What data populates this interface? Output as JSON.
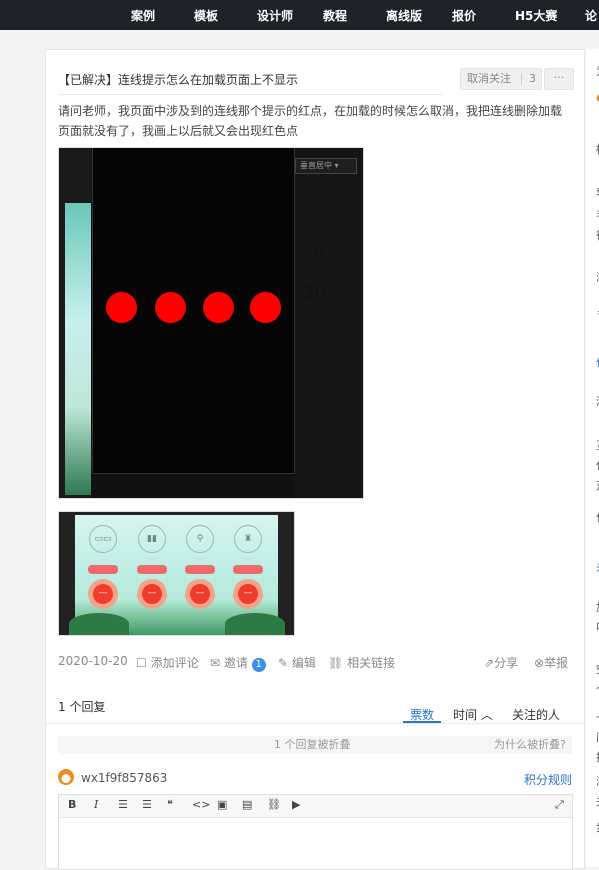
{
  "nav": {
    "items": [
      "案例",
      "模板",
      "设计师",
      "教程",
      "离线版",
      "报价",
      "H5大赛",
      "论"
    ]
  },
  "question": {
    "title": "【已解决】连线提示怎么在加载页面上不显示",
    "unfollow_label": "取消关注",
    "follow_count": "3",
    "more_label": "···",
    "body": "请问老师，我页面中涉及到的连线那个提示的红点，在加载的时候怎么取消，我把连线删除加载页面就没有了，我画上以后就又会出现红色点"
  },
  "screenshot1": {
    "dropdown_label": "垂直居中 ▾",
    "number_top": "0",
    "number_bottom": "30",
    "dot_color": "#ff0000"
  },
  "meta": {
    "date": "2020-10-20",
    "add_comment": "添加评论",
    "invite": "邀请",
    "invite_badge": "1",
    "edit": "编辑",
    "related_links": "相关链接",
    "share": "分享",
    "report": "举报"
  },
  "answers": {
    "count_label": "1 个回复",
    "tabs": [
      "票数",
      "时间 ︿",
      "关注的人"
    ],
    "folded_text": "1 个回复被折叠",
    "why_folded": "为什么被折叠?"
  },
  "editor": {
    "username": "wx1f9f857863",
    "rules_link": "积分规则",
    "toolbar": [
      "B",
      "I",
      "☰",
      "☰",
      "❝",
      "<>",
      "▣",
      "▤",
      "⛓",
      "▶"
    ],
    "fullscreen": "⤢"
  },
  "right_panel": {
    "chars": [
      "为",
      "●",
      "标",
      "导",
      "手",
      "径",
      "浏",
      "〒",
      "作",
      "浏",
      "互",
      "作",
      "对",
      "作",
      "未",
      "加",
      "叫",
      "空",
      "个",
      "一",
      "问",
      "推",
      "浏",
      "关",
      "步"
    ]
  },
  "colors": {
    "nav_bg": "#1f2229",
    "accent": "#2a74c9",
    "badge": "#3b8fe5"
  }
}
